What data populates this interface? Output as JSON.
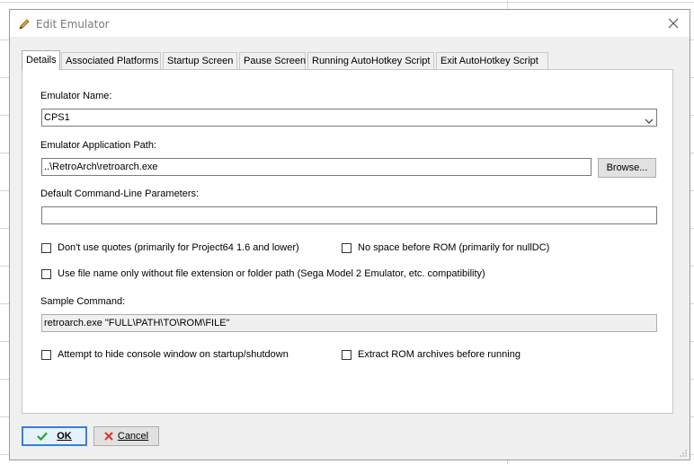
{
  "window": {
    "title": "Edit Emulator",
    "icons": {
      "title": "pencil-icon",
      "close": "close-icon"
    }
  },
  "tabs": [
    {
      "label": "Details",
      "active": true
    },
    {
      "label": "Associated Platforms",
      "active": false
    },
    {
      "label": "Startup Screen",
      "active": false
    },
    {
      "label": "Pause Screen",
      "active": false
    },
    {
      "label": "Running AutoHotkey Script",
      "active": false
    },
    {
      "label": "Exit AutoHotkey Script",
      "active": false
    }
  ],
  "details": {
    "emulator_name_label": "Emulator Name:",
    "emulator_name_value": "CPS1",
    "app_path_label": "Emulator Application Path:",
    "app_path_value": "..\\RetroArch\\retroarch.exe",
    "browse_label": "Browse...",
    "cmdline_label": "Default Command-Line Parameters:",
    "cmdline_value": "",
    "checkboxes": {
      "no_quotes": {
        "label": "Don't use quotes (primarily for Project64 1.6 and lower)",
        "checked": false
      },
      "no_space": {
        "label": "No space before ROM (primarily for nullDC)",
        "checked": false
      },
      "file_name_only": {
        "label": "Use file name only without file extension or folder path (Sega Model 2 Emulator, etc. compatibility)",
        "checked": false
      },
      "hide_console": {
        "label": "Attempt to hide console window on startup/shutdown",
        "checked": false
      },
      "extract_rom": {
        "label": "Extract ROM archives before running",
        "checked": false
      }
    },
    "sample_command_label": "Sample Command:",
    "sample_command_value": "retroarch.exe \"FULL\\PATH\\TO\\ROM\\FILE\""
  },
  "footer": {
    "ok_label": "OK",
    "cancel_label": "Cancel",
    "ok_icon": "checkmark-icon",
    "cancel_icon": "x-icon",
    "colors": {
      "ok_icon": "#22a822",
      "cancel_icon": "#d9342b",
      "focus_border": "#3b7ed8"
    }
  }
}
